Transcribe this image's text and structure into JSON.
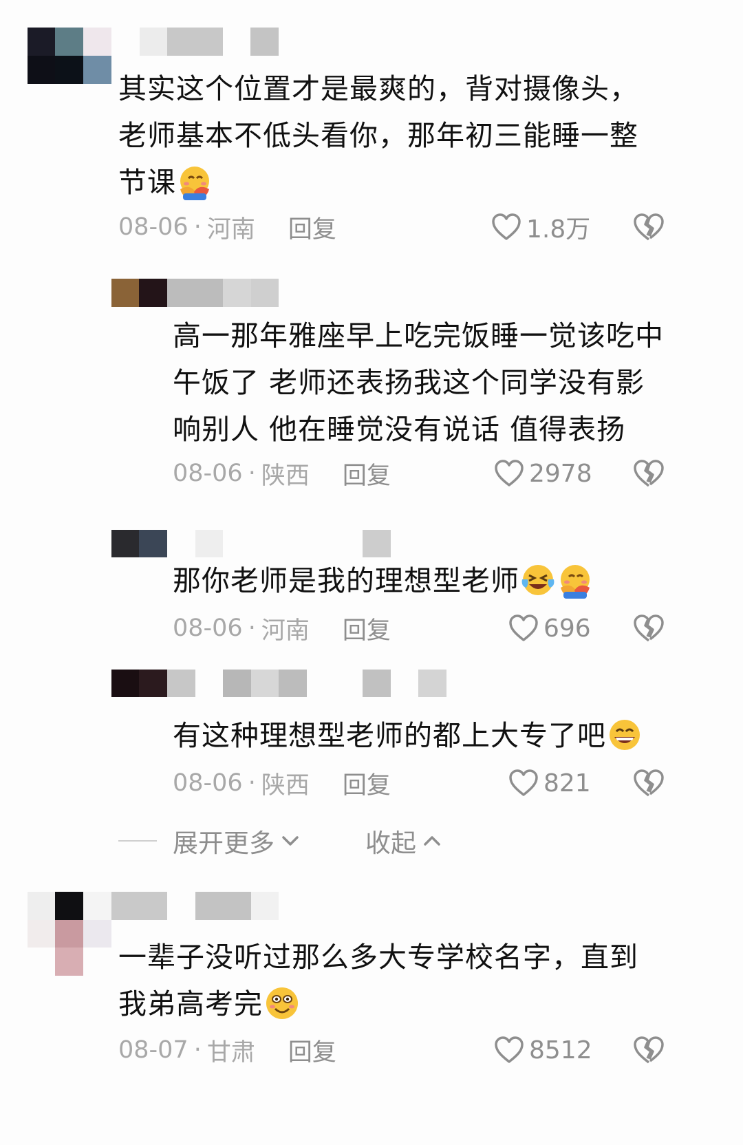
{
  "colors": {
    "background": "#fdfdfd",
    "text": "#111111",
    "meta": "#a8a8a8",
    "action": "#8e8e8e"
  },
  "comments": [
    {
      "lines": [
        "其实这个位置才是最爽的，背对摄像头，",
        "老师基本不低头看你，那年初三能睡一整",
        "节课"
      ],
      "emoji": [
        "hugging-face-icon"
      ],
      "date": "08-06",
      "location": "河南",
      "reply": "回复",
      "likes": "1.8万"
    },
    {
      "lines": [
        "高一那年雅座早上吃完饭睡一觉该吃中",
        "午饭了 老师还表扬我这个同学没有影",
        "响别人 他在睡觉没有说话 值得表扬"
      ],
      "emoji": [],
      "date": "08-06",
      "location": "陕西",
      "reply": "回复",
      "likes": "2978"
    },
    {
      "lines": [
        "那你老师是我的理想型老师"
      ],
      "emoji": [
        "crying-laughing-icon",
        "hugging-face-icon"
      ],
      "date": "08-06",
      "location": "河南",
      "reply": "回复",
      "likes": "696"
    },
    {
      "lines": [
        "有这种理想型老师的都上大专了吧"
      ],
      "emoji": [
        "grinning-face-icon"
      ],
      "date": "08-06",
      "location": "陕西",
      "reply": "回复",
      "likes": "821"
    },
    {
      "lines": [
        "一辈子没听过那么多大专学校名字，直到",
        "我弟高考完"
      ],
      "emoji": [
        "smiling-face-icon"
      ],
      "date": "08-07",
      "location": "甘肃",
      "reply": "回复",
      "likes": "8512"
    }
  ],
  "thread_controls": {
    "expand": "展开更多",
    "collapse": "收起"
  }
}
